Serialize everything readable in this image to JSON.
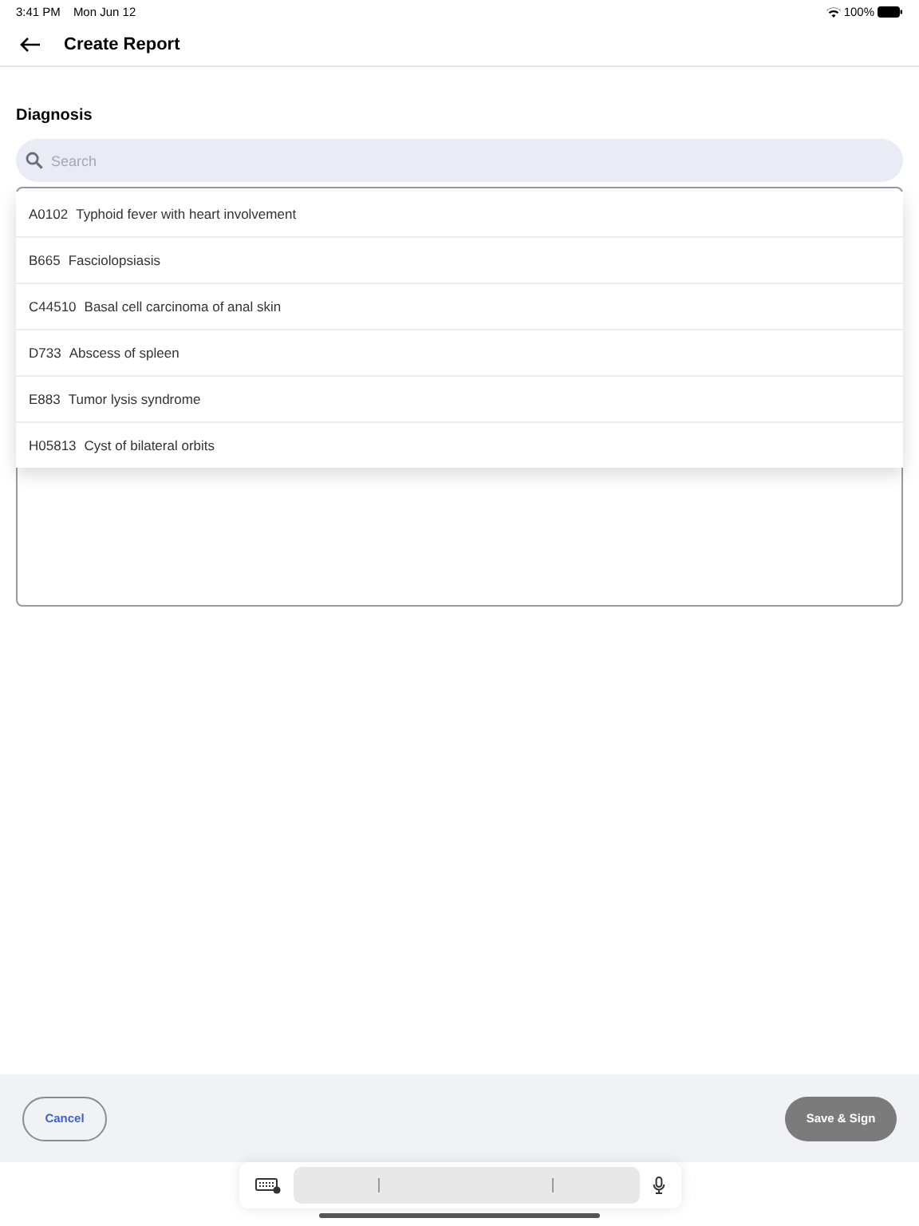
{
  "status_bar": {
    "time": "3:41 PM",
    "date": "Mon Jun 12",
    "battery": "100%"
  },
  "header": {
    "title": "Create Report"
  },
  "diagnosis": {
    "label": "Diagnosis",
    "search": {
      "placeholder": "Search"
    },
    "results": [
      {
        "code": "A0102",
        "name": "Typhoid fever with heart involvement"
      },
      {
        "code": "B665",
        "name": "Fasciolopsiasis"
      },
      {
        "code": "C44510",
        "name": "Basal cell carcinoma of anal skin"
      },
      {
        "code": "D733",
        "name": "Abscess of spleen"
      },
      {
        "code": "E883",
        "name": "Tumor lysis syndrome"
      },
      {
        "code": "H05813",
        "name": "Cyst of bilateral orbits"
      }
    ]
  },
  "footer": {
    "cancel": "Cancel",
    "save": "Save & Sign"
  }
}
